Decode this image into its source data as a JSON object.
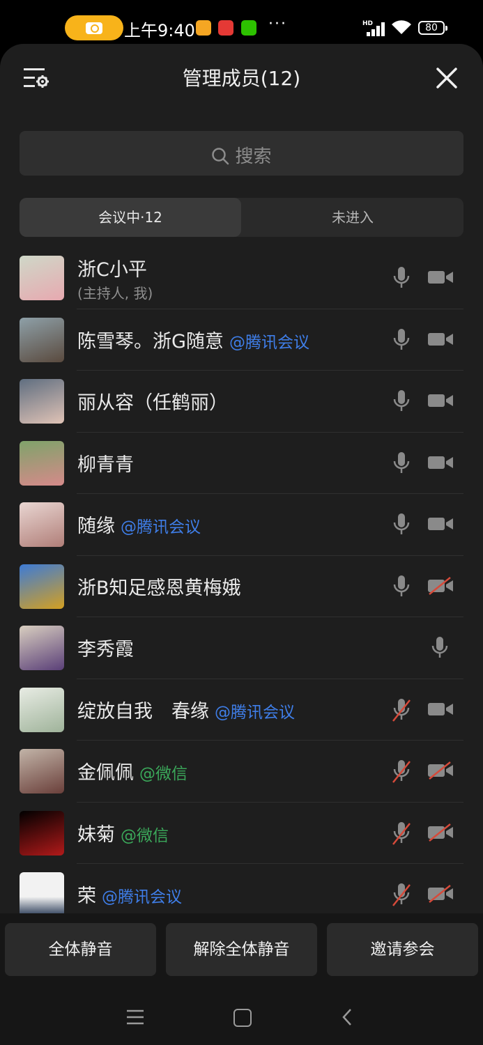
{
  "status_bar": {
    "time": "上午9:40",
    "battery": "80",
    "network": "HD",
    "more": "···"
  },
  "header": {
    "title": "管理成员(12)"
  },
  "search": {
    "placeholder": "搜索"
  },
  "tabs": {
    "in_meeting": "会议中·12",
    "not_joined": "未进入"
  },
  "members": [
    {
      "name": "浙C小平",
      "role": "(主持人, 我)",
      "tag": "",
      "mic": "on",
      "video": "on"
    },
    {
      "name": "陈雪琴。浙G随意",
      "tag": "@腾讯会议",
      "mic": "on",
      "video": "on"
    },
    {
      "name": "丽从容（任鹤丽）",
      "tag": "",
      "mic": "on",
      "video": "on"
    },
    {
      "name": "柳青青",
      "tag": "",
      "mic": "on",
      "video": "on"
    },
    {
      "name": "随缘",
      "tag": "@腾讯会议",
      "mic": "on",
      "video": "on"
    },
    {
      "name": "浙B知足感恩黄梅娥",
      "tag": "",
      "mic": "on",
      "video": "off"
    },
    {
      "name": "李秀霞",
      "tag": "",
      "mic": "on",
      "video": "none"
    },
    {
      "name": "绽放自我　春缘",
      "tag": "@腾讯会议",
      "mic": "off",
      "video": "on"
    },
    {
      "name": "金佩佩",
      "tag": "@微信",
      "mic": "off",
      "video": "off"
    },
    {
      "name": "妹菊",
      "tag": "@微信",
      "mic": "off",
      "video": "off"
    },
    {
      "name": "荣",
      "tag": "@腾讯会议",
      "mic": "off",
      "video": "off"
    }
  ],
  "footer": {
    "mute_all": "全体静音",
    "unmute_all": "解除全体静音",
    "invite": "邀请参会"
  },
  "colors": {
    "tencent_tag": "#3f7ee8",
    "wechat_tag": "#3ba85a",
    "muted_slash": "#d64a3a"
  }
}
